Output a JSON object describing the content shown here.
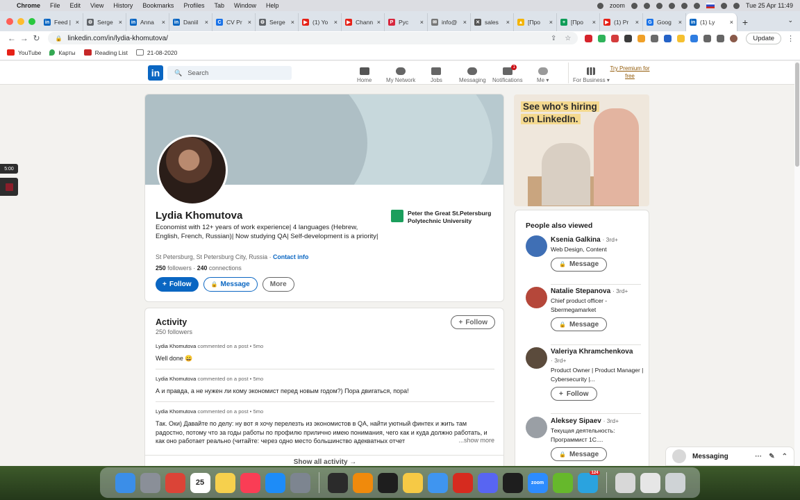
{
  "menubar": {
    "app": "Chrome",
    "items": [
      "File",
      "Edit",
      "View",
      "History",
      "Bookmarks",
      "Profiles",
      "Tab",
      "Window",
      "Help"
    ],
    "tray_app": "zoom",
    "clock": "Tue 25 Apr  11:49"
  },
  "tabs": [
    {
      "label": "Feed |",
      "color": "#0a66c2",
      "glyph": "in"
    },
    {
      "label": "Serge",
      "color": "#5f6368",
      "glyph": "⚙"
    },
    {
      "label": "Anna",
      "color": "#0a66c2",
      "glyph": "in"
    },
    {
      "label": "Daniil",
      "color": "#0a66c2",
      "glyph": "in"
    },
    {
      "label": "CV Pr",
      "color": "#1a73e8",
      "glyph": "C"
    },
    {
      "label": "Serge",
      "color": "#5f6368",
      "glyph": "⚙"
    },
    {
      "label": "(1) Yo",
      "color": "#e62117",
      "glyph": "▶"
    },
    {
      "label": "Chann",
      "color": "#e62117",
      "glyph": "▶"
    },
    {
      "label": "Рус",
      "color": "#d7263d",
      "glyph": "Р"
    },
    {
      "label": "info@",
      "color": "#777777",
      "glyph": "✉"
    },
    {
      "label": "sales",
      "color": "#555555",
      "glyph": "✕"
    },
    {
      "label": "[Про",
      "color": "#f4b400",
      "glyph": "▲"
    },
    {
      "label": "[Про",
      "color": "#0f9d58",
      "glyph": "+"
    },
    {
      "label": "(1) Pr",
      "color": "#e62117",
      "glyph": "▶"
    },
    {
      "label": "Goog",
      "color": "#1a73e8",
      "glyph": "G"
    },
    {
      "label": "(1) Ly",
      "color": "#0a66c2",
      "glyph": "in",
      "active": true
    }
  ],
  "address": {
    "url": "linkedin.com/in/lydia-khomutova/",
    "update_label": "Update"
  },
  "bookmarks": [
    {
      "label": "YouTube",
      "color": "#e62117"
    },
    {
      "label": "Карты",
      "color": "#34a853"
    },
    {
      "label": "Reading List",
      "color": "#c62828"
    },
    {
      "label": "21-08-2020",
      "color": "#777777"
    }
  ],
  "linkedin_nav": {
    "logo": "in",
    "search_placeholder": "Search",
    "items": {
      "home": "Home",
      "network": "My Network",
      "jobs": "Jobs",
      "messaging": "Messaging",
      "notifications": "Notifications",
      "me": "Me",
      "business": "For Business"
    },
    "home_badge": "",
    "notifications_badge": "1",
    "premium": "Try Premium for free"
  },
  "timer": "5:00",
  "profile": {
    "name": "Lydia Khomutova",
    "headline": "Economist with 12+ years of work experience| 4 languages (Hebrew, English, French, Russian)| Now studying QA| Self-development is a priority|",
    "location": "St Petersburg, St Petersburg City, Russia",
    "contact_info": "Contact info",
    "followers": "250",
    "followers_label": "followers",
    "connections": "240",
    "connections_label": "connections",
    "follow_label": "Follow",
    "message_label": "Message",
    "more_label": "More",
    "education": "Peter the Great St.Petersburg Polytechnic University"
  },
  "activity": {
    "title": "Activity",
    "subtitle": "250 followers",
    "follow_label": "Follow",
    "posts": [
      {
        "author": "Lydia Khomutova",
        "action": "commented on a post",
        "time": "5mo",
        "text": "Well done 😀"
      },
      {
        "author": "Lydia Khomutova",
        "action": "commented on a post",
        "time": "5mo",
        "text": "А и правда, а не нужен ли кому экономист перед новым годом?) Пора двигаться, пора!"
      },
      {
        "author": "Lydia Khomutova",
        "action": "commented on a post",
        "time": "5mo",
        "text": "Так. Оки) Давайте по делу: ну вот я хочу перелезть из экономистов в QA, найти уютный финтех и жить там радостно, потому что за годы работы по профилю прилично имею понимания, чего как и куда должно работать, и как оно работает реально (читайте: через одно место большинство адекватных отчет",
        "more": "...show more"
      }
    ],
    "show_all": "Show all activity →"
  },
  "ad": {
    "line1": "See who's hiring",
    "line2": "on LinkedIn."
  },
  "people_also_viewed": {
    "title": "People also viewed",
    "people": [
      {
        "name": "Ksenia Galkina",
        "degree": "· 3rd+",
        "title": "Web Design, Content",
        "button": "Message",
        "color": "#3f6fb5"
      },
      {
        "name": "Natalie Stepanova",
        "degree": "· 3rd+",
        "title": "Chief product officer - Sbermegamarket",
        "button": "Message",
        "color": "#b5473a"
      },
      {
        "name": "Valeriya Khramchenkova",
        "degree": "· 3rd+",
        "title": "Product Owner | Product Manager | Cybersecurity |...",
        "button": "Follow",
        "color": "#5b4b3c"
      },
      {
        "name": "Aleksey Sipaev",
        "degree": "· 3rd+",
        "title": "Текущая деятельность: Программист 1С....",
        "button": "Message",
        "color": "#9a9fa5"
      }
    ]
  },
  "messaging": {
    "label": "Messaging"
  },
  "dock": [
    {
      "name": "finder",
      "color": "#3b8ee8"
    },
    {
      "name": "launchpad",
      "color": "#8a8f98"
    },
    {
      "name": "chrome",
      "color": "#db4437"
    },
    {
      "name": "calendar",
      "color": "#ffffff",
      "glyph": "25"
    },
    {
      "name": "notes",
      "color": "#f6d04d"
    },
    {
      "name": "music",
      "color": "#fa3d55"
    },
    {
      "name": "app-store",
      "color": "#1d8cf8"
    },
    {
      "name": "settings",
      "color": "#7d8590"
    },
    {
      "name": "activity-monitor",
      "color": "#2b2b2b"
    },
    {
      "name": "vlc",
      "color": "#f08a0c"
    },
    {
      "name": "terminal",
      "color": "#1e1e1e"
    },
    {
      "name": "cyberduck",
      "color": "#f6c945"
    },
    {
      "name": "mail",
      "color": "#3f95f0"
    },
    {
      "name": "acrobat",
      "color": "#d62b1f"
    },
    {
      "name": "discord",
      "color": "#5865f2"
    },
    {
      "name": "figma",
      "color": "#1e1e1e"
    },
    {
      "name": "zoom",
      "color": "#2d8cff",
      "glyph": "zoom"
    },
    {
      "name": "utorrent",
      "color": "#66b82c"
    },
    {
      "name": "telegram",
      "color": "#2aa3df",
      "badge": "124"
    }
  ]
}
